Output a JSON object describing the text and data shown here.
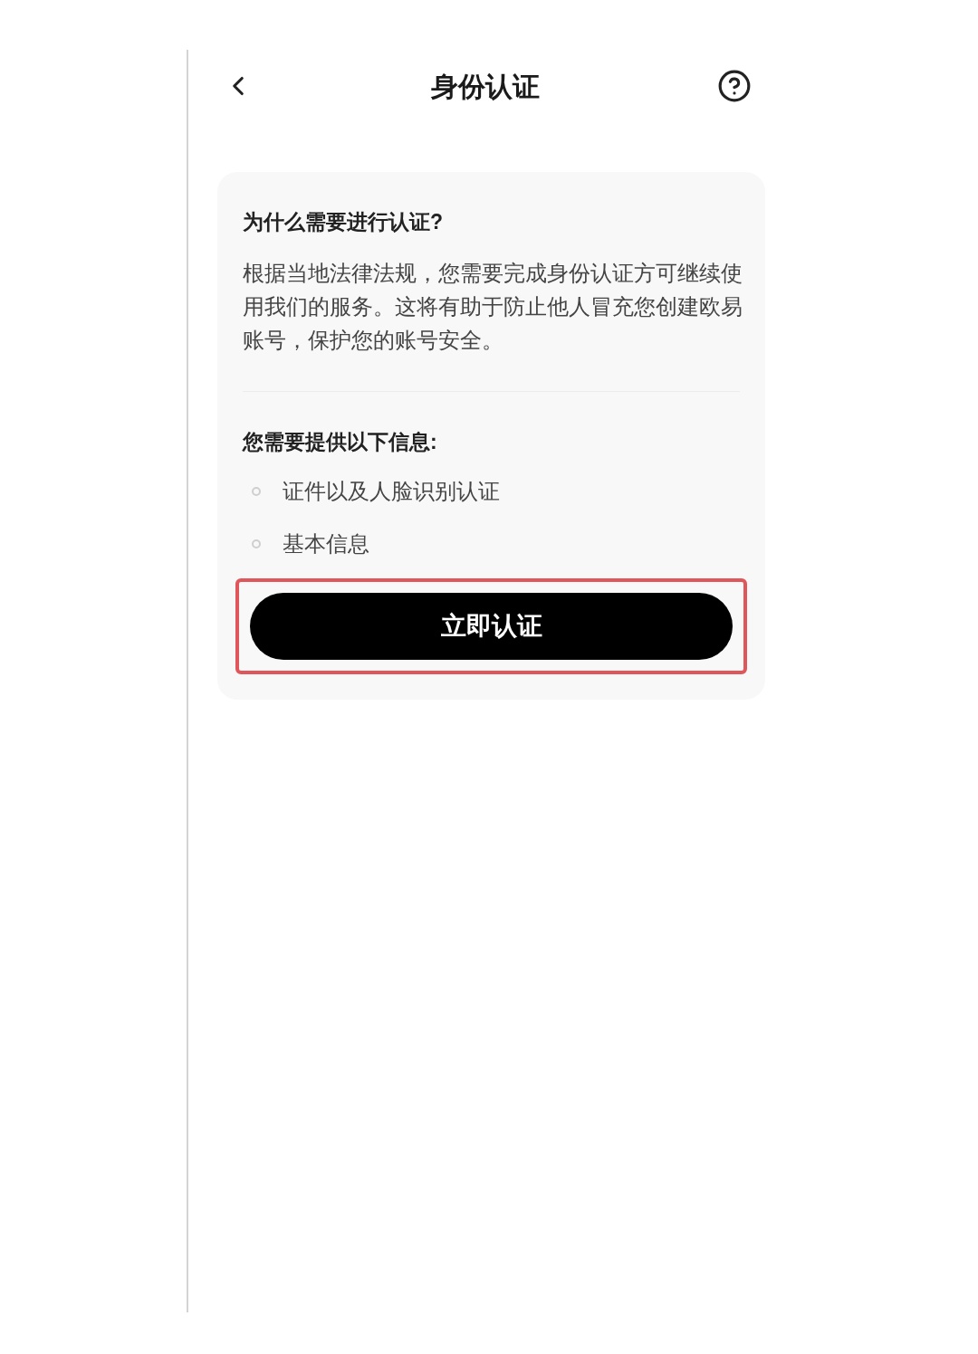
{
  "header": {
    "title": "身份认证"
  },
  "card": {
    "heading": "为什么需要进行认证?",
    "paragraph": "根据当地法律法规，您需要完成身份认证方可继续使用我们的服务。这将有助于防止他人冒充您创建欧易账号，保护您的账号安全。",
    "list_heading": "您需要提供以下信息:",
    "items": [
      "证件以及人脸识别认证",
      "基本信息"
    ]
  },
  "button": {
    "label": "立即认证",
    "highlighted": true
  }
}
